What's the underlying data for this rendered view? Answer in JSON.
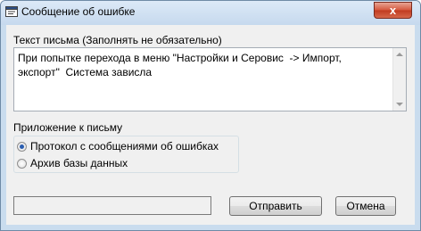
{
  "window": {
    "title": "Сообщение об ошибке",
    "close_label": "x"
  },
  "message": {
    "label": "Текст письма (Заполнять не обязательно)",
    "value": "При попытке перехода в меню \"Настройки и Серовис  -> Импорт,\nэкспорт\"  Система зависла"
  },
  "attachment": {
    "label": "Приложение к письму",
    "options": [
      {
        "label": "Протокол с сообщениями об ошибках",
        "checked": true
      },
      {
        "label": "Архив базы данных",
        "checked": false
      }
    ]
  },
  "buttons": {
    "send": "Отправить",
    "cancel": "Отмена"
  }
}
